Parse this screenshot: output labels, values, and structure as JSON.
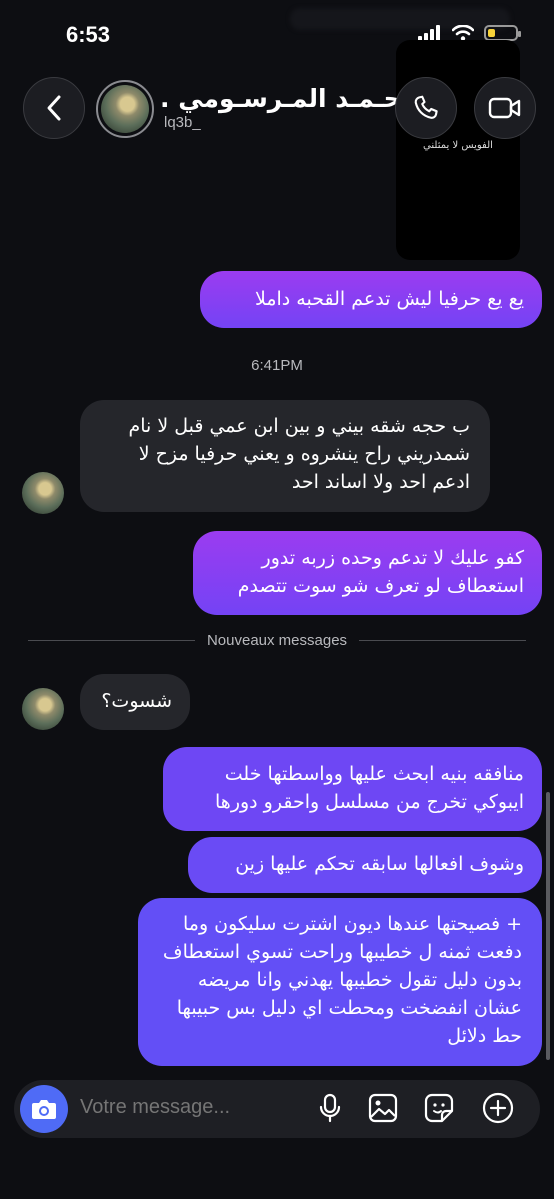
{
  "status_bar": {
    "time": "6:53"
  },
  "header": {
    "contact_name": "محـمـد المـرسـومي .",
    "contact_handle": "lq3b_"
  },
  "story_preview": {
    "text": "الفويس لا يمثلني"
  },
  "messages": [
    {
      "side": "sent",
      "text": "يع يع حرفيا ليش تدعم القحبه داملا"
    },
    {
      "type": "timestamp",
      "text": "6:41PM"
    },
    {
      "side": "received",
      "text": "ب حجه شقه بيني و بين ابن عمي قبل لا نام شمدريني راح ينشروه و يعني حرفيا مزح لا ادعم احد ولا اساند احد"
    },
    {
      "side": "sent",
      "text": "كفو عليك لا تدعم وحده زربه تدور استعطاف لو تعرف شو سوت تتصدم"
    },
    {
      "type": "divider",
      "text": "Nouveaux messages"
    },
    {
      "side": "received",
      "text": "شسوت؟"
    },
    {
      "side": "sent",
      "text": "منافقه بنيه ابحث عليها وواسطتها خلت ايبوكي تخرج من مسلسل واحقرو دورها"
    },
    {
      "side": "sent",
      "text": "وشوف افعالها سابقه تحكم عليها زين"
    },
    {
      "side": "sent",
      "text": "+ فصيحتها عندها ديون اشترت سليكون وما دفعت ثمنه ل خطيبها وراحت تسوي استعطاف بدون دليل تقول خطيبها يهدني وانا مريضه عشان انفضخت ومحطت اي دليل بس حبيبها حط دلائل"
    }
  ],
  "composer": {
    "placeholder": "Votre message..."
  },
  "icons": {
    "back": "chevron-left-icon",
    "call": "phone-icon",
    "video": "video-camera-icon",
    "camera": "camera-icon",
    "mic": "microphone-icon",
    "gallery": "image-icon",
    "sticker": "sticker-icon",
    "add": "plus-circle-icon"
  },
  "colors": {
    "sent_bubble": "#8a3ff2",
    "received_bubble": "#25262b",
    "background": "#0d0e12",
    "camera_button": "#4f6bf6"
  }
}
